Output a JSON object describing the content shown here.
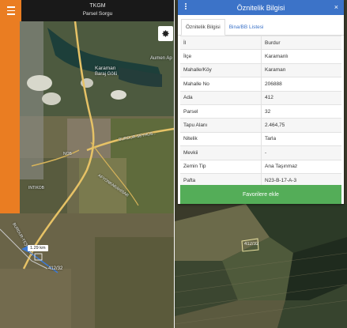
{
  "app": {
    "title": "TKGM",
    "subtitle": "Parsel Sorgu"
  },
  "map_left": {
    "labels": {
      "place_aumena": "Aumen Ap",
      "place_karaman": "Karaman",
      "place_baraj": "Baraj Gölü",
      "road_burdur": "BURDUR-SEYHÜS...",
      "road_afyon": "AFYONKARAHİSAR",
      "road_burdur2": "BURDUR-YEŞİLOVA",
      "area_west": "NOB",
      "area_sw": "INTIKOB"
    },
    "distance": "1.29 km",
    "parcel_label": "412/32"
  },
  "panel": {
    "title": "Öznitelik Bilgisi",
    "close": "×",
    "tabs": [
      "Öznitelik Bilgisi",
      "Bina/BB Listesi"
    ],
    "rows": [
      {
        "key": "İl",
        "value": "Burdur"
      },
      {
        "key": "İlçe",
        "value": "Karamanlı"
      },
      {
        "key": "Mahalle/Köy",
        "value": "Karaman"
      },
      {
        "key": "Mahalle No",
        "value": "206888"
      },
      {
        "key": "Ada",
        "value": "412"
      },
      {
        "key": "Parsel",
        "value": "32"
      },
      {
        "key": "Tapu Alanı",
        "value": "2.464,75"
      },
      {
        "key": "Nitelik",
        "value": "Tarla"
      },
      {
        "key": "Mevkii",
        "value": "-"
      },
      {
        "key": "Zemin Tip",
        "value": "Ana Taşınmaz"
      },
      {
        "key": "Pafta",
        "value": "N23-B-17-A-3"
      }
    ],
    "favorite_button": "Favorilere ekle"
  },
  "map_right": {
    "parcel_label": "412/32"
  },
  "colors": {
    "accent_orange": "#ea7d22",
    "header_blue": "#3c73c8",
    "button_green": "#54ad58"
  }
}
